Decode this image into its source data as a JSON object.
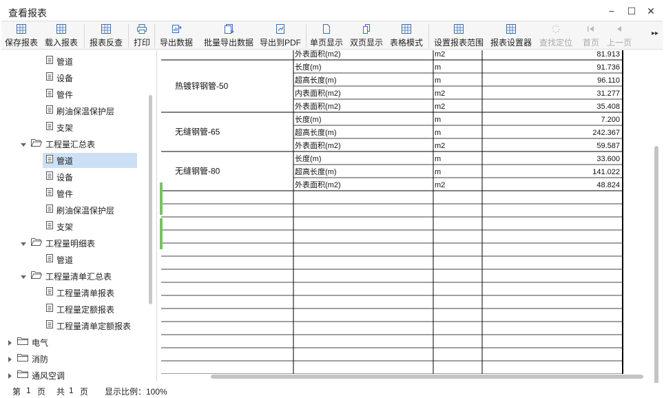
{
  "window": {
    "title": "查看报表",
    "minimize": "−",
    "maximize": "☐",
    "close": "✕"
  },
  "toolbar": {
    "buttons": [
      {
        "label": "保存报表",
        "icon": "save-report-icon",
        "enabled": true
      },
      {
        "label": "载入报表",
        "icon": "load-report-icon",
        "enabled": true
      },
      {
        "label": "报表反查",
        "icon": "reverse-lookup-icon",
        "enabled": true
      },
      {
        "label": "打印",
        "icon": "print-icon",
        "enabled": true
      },
      {
        "label": "导出数据",
        "icon": "export-data-icon",
        "enabled": true
      },
      {
        "label": "批量导出数据",
        "icon": "batch-export-icon",
        "enabled": true
      },
      {
        "label": "导出到PDF",
        "icon": "export-pdf-icon",
        "enabled": true
      },
      {
        "label": "单页显示",
        "icon": "single-page-icon",
        "enabled": true
      },
      {
        "label": "双页显示",
        "icon": "double-page-icon",
        "enabled": true
      },
      {
        "label": "表格模式",
        "icon": "table-mode-icon",
        "enabled": true
      },
      {
        "label": "设置报表范围",
        "icon": "report-range-icon",
        "enabled": true
      },
      {
        "label": "报表设置器",
        "icon": "report-settings-icon",
        "enabled": true
      },
      {
        "label": "查找定位",
        "icon": "find-locate-icon",
        "enabled": false
      },
      {
        "label": "首页",
        "icon": "first-page-icon",
        "enabled": false
      },
      {
        "label": "上一页",
        "icon": "prev-page-icon",
        "enabled": false
      }
    ],
    "more": "▸▸"
  },
  "tree": {
    "items": [
      {
        "label": "管道",
        "type": "doc",
        "level": 3
      },
      {
        "label": "设备",
        "type": "doc",
        "level": 3
      },
      {
        "label": "管件",
        "type": "doc",
        "level": 3
      },
      {
        "label": "刷油保温保护层",
        "type": "doc",
        "level": 3
      },
      {
        "label": "支架",
        "type": "doc",
        "level": 3
      },
      {
        "label": "工程量汇总表",
        "type": "folder-open",
        "level": 2
      },
      {
        "label": "管道",
        "type": "doc",
        "level": 3,
        "selected": true
      },
      {
        "label": "设备",
        "type": "doc",
        "level": 3
      },
      {
        "label": "管件",
        "type": "doc",
        "level": 3
      },
      {
        "label": "刷油保温保护层",
        "type": "doc",
        "level": 3
      },
      {
        "label": "支架",
        "type": "doc",
        "level": 3
      },
      {
        "label": "工程量明细表",
        "type": "folder-open",
        "level": 2
      },
      {
        "label": "管道",
        "type": "doc",
        "level": 3
      },
      {
        "label": "工程量清单汇总表",
        "type": "folder-open",
        "level": 2
      },
      {
        "label": "工程量清单报表",
        "type": "doc",
        "level": 3
      },
      {
        "label": "工程量定额报表",
        "type": "doc",
        "level": 3
      },
      {
        "label": "工程量清单定额报表",
        "type": "doc",
        "level": 3
      },
      {
        "label": "电气",
        "type": "folder-closed",
        "level": 1
      },
      {
        "label": "消防",
        "type": "folder-closed",
        "level": 1
      },
      {
        "label": "通风空调",
        "type": "folder-closed",
        "level": 1
      }
    ]
  },
  "report": {
    "groups": [
      {
        "name": "",
        "rows": [
          {
            "item": "外表面积(m2)",
            "unit": "m2",
            "value": "81.913"
          }
        ]
      },
      {
        "name": "热镀锌钢管-50",
        "rows": [
          {
            "item": "长度(m)",
            "unit": "m",
            "value": "91.736"
          },
          {
            "item": "超高长度(m)",
            "unit": "m",
            "value": "96.110"
          },
          {
            "item": "内表面积(m2)",
            "unit": "m2",
            "value": "31.277"
          },
          {
            "item": "外表面积(m2)",
            "unit": "m2",
            "value": "35.408"
          }
        ]
      },
      {
        "name": "无缝钢管-65",
        "rows": [
          {
            "item": "长度(m)",
            "unit": "m",
            "value": "7.200"
          },
          {
            "item": "超高长度(m)",
            "unit": "m",
            "value": "242.367"
          },
          {
            "item": "外表面积(m2)",
            "unit": "m2",
            "value": "59.587"
          }
        ]
      },
      {
        "name": "无缝钢管-80",
        "rows": [
          {
            "item": "长度(m)",
            "unit": "m",
            "value": "33.600"
          },
          {
            "item": "超高长度(m)",
            "unit": "m",
            "value": "141.022"
          },
          {
            "item": "外表面积(m2)",
            "unit": "m2",
            "value": "48.824"
          }
        ]
      }
    ],
    "empty_rows": 14
  },
  "status": {
    "page_prefix": "第",
    "page_current": "1",
    "page_unit": "页",
    "total_prefix": "共",
    "total_pages": "1",
    "total_unit": "页",
    "zoom": "显示比例：100%"
  },
  "colors": {
    "icon_blue": "#3a6db3",
    "selected_bg": "#cce0f5",
    "green_marker": "#7bbf6a"
  }
}
